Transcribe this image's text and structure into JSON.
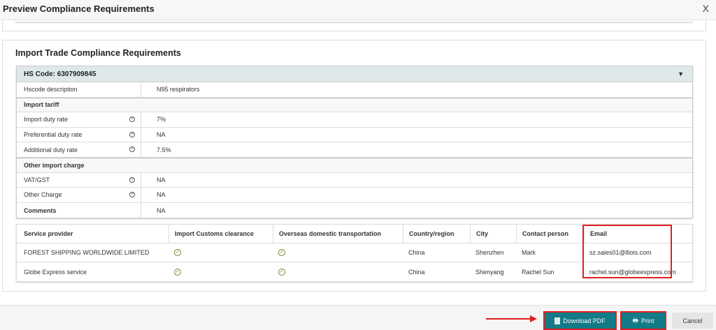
{
  "dialog": {
    "title": "Preview Compliance Requirements",
    "close": "X"
  },
  "section_title": "Import Trade Compliance Requirements",
  "hs": {
    "label": "HS Code:",
    "code": "6307909845",
    "rows": [
      {
        "key": "Hscode description",
        "value": "N95 respirators",
        "type": "plain"
      },
      {
        "key": "Import tariff",
        "type": "section"
      },
      {
        "key": "Import duty rate",
        "value": "7%",
        "help": true
      },
      {
        "key": "Preferential duty rate",
        "value": "NA",
        "help": true
      },
      {
        "key": "Additional duty rate",
        "value": "7.5%",
        "help": true
      },
      {
        "key": "Other import charge",
        "type": "section"
      },
      {
        "key": "VAT/GST",
        "value": "NA",
        "help": true
      },
      {
        "key": "Other Charge",
        "value": "NA",
        "help": true
      },
      {
        "key": "Comments",
        "value": "NA",
        "type": "bold"
      }
    ]
  },
  "providers": {
    "columns": [
      "Service provider",
      "Import Customs clearance",
      "Overseas domestic transportation",
      "Country/region",
      "City",
      "Contact person",
      "Email"
    ],
    "rows": [
      {
        "provider": "FOREST SHIPPING WORLDWIDE LIMITED",
        "customs": true,
        "transport": true,
        "country": "China",
        "city": "Shenzhen",
        "contact": "Mark",
        "email": "sz.sales01@lllois.com"
      },
      {
        "provider": "Globe Express service",
        "customs": true,
        "transport": true,
        "country": "China",
        "city": "Shenyang",
        "contact": "Rachel Sun",
        "email": "rachel.sun@globeexpress.com"
      }
    ]
  },
  "footer": {
    "download": "Download PDF",
    "print": "Print",
    "cancel": "Cancel"
  },
  "colors": {
    "accent": "#127b87",
    "highlight": "#e02020",
    "check": "#6a8a2a"
  }
}
